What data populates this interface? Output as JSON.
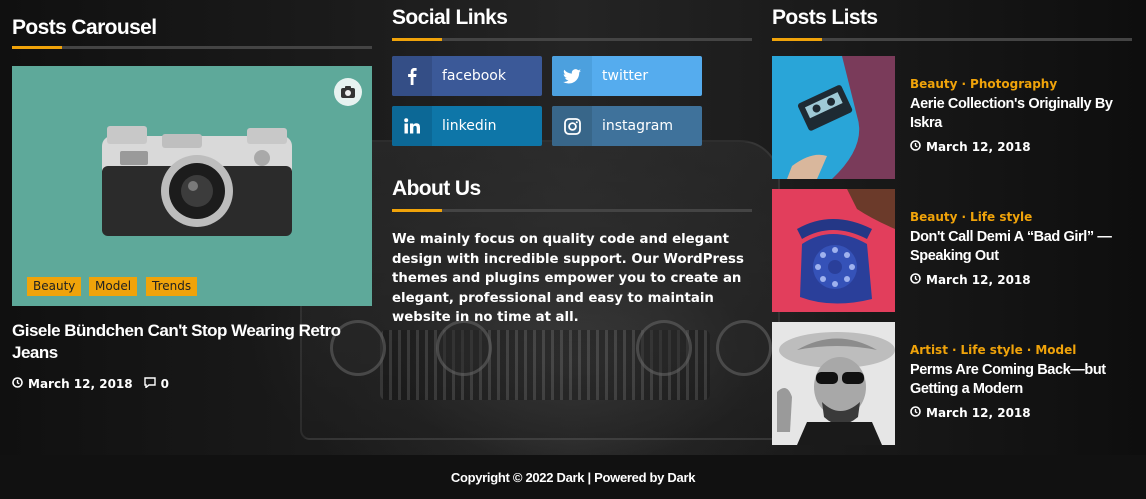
{
  "carousel": {
    "heading": "Posts Carousel",
    "tags": [
      "Beauty",
      "Model",
      "Trends"
    ],
    "post_title": "Gisele Bündchen Can't Stop Wearing Retro Jeans",
    "date": "March 12, 2018",
    "comments": "0"
  },
  "social": {
    "heading": "Social Links",
    "links": [
      {
        "label": "facebook",
        "icon": "facebook-icon",
        "color": "#3b5998",
        "icon_bg": "#344e86"
      },
      {
        "label": "twitter",
        "icon": "twitter-icon",
        "color": "#55acee",
        "icon_bg": "#4ca0de"
      },
      {
        "label": "linkedin",
        "icon": "linkedin-icon",
        "color": "#0e76a8",
        "icon_bg": "#0c6896"
      },
      {
        "label": "instagram",
        "icon": "instagram-icon",
        "color": "#3f729b",
        "icon_bg": "#386689"
      }
    ]
  },
  "about": {
    "heading": "About Us",
    "text": "We mainly focus on quality code and elegant design with incredible support. Our WordPress themes and plugins empower you to create an elegant, professional and easy to maintain website in no time at all."
  },
  "posts": {
    "heading": "Posts Lists",
    "items": [
      {
        "categories": [
          "Beauty",
          "Photography"
        ],
        "title": "Aerie Collection's Originally By Iskra",
        "date": "March 12, 2018"
      },
      {
        "categories": [
          "Beauty",
          "Life style"
        ],
        "title": "Don't Call Demi A “Bad Girl” — Speaking Out",
        "date": "March 12, 2018"
      },
      {
        "categories": [
          "Artist",
          "Life style",
          "Model"
        ],
        "title": "Perms Are Coming Back—but Getting a Modern",
        "date": "March 12, 2018"
      }
    ]
  },
  "footer": {
    "copyright": "Copyright © 2022 Dark | Powered by Dark"
  },
  "colors": {
    "accent": "#f0a30a",
    "background": "#141414"
  }
}
